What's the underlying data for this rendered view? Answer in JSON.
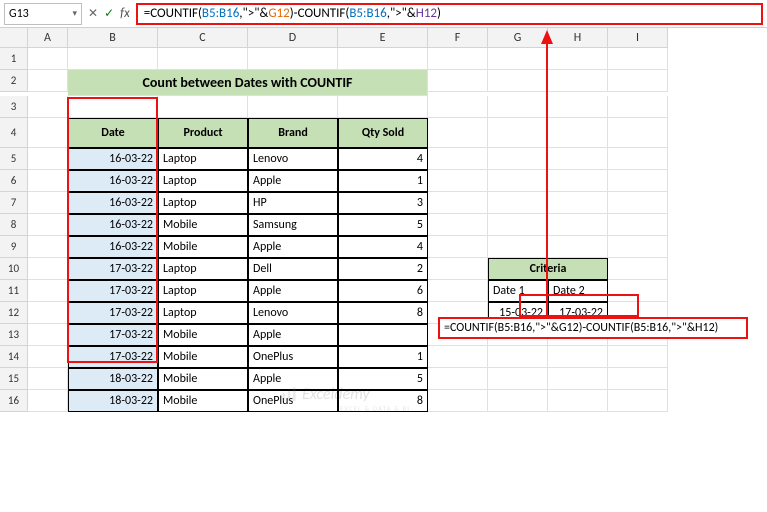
{
  "nameBox": "G13",
  "formulaBar": {
    "prefix": "=COUNTIF(",
    "r1": "B5:B16",
    "mid1": ",\">\"&",
    "g12": "G12",
    "mid2": ")-COUNTIF(",
    "r2": "B5:B16",
    "mid3": ",\">\"&",
    "h12": "H12",
    "suffix": ")"
  },
  "colHeaders": [
    "",
    "A",
    "B",
    "C",
    "D",
    "E",
    "F",
    "G",
    "H",
    "I"
  ],
  "title": "Count between Dates with COUNTIF",
  "headers": {
    "date": "Date",
    "product": "Product",
    "brand": "Brand",
    "qty": "Qty Sold"
  },
  "rows": [
    {
      "date": "16-03-22",
      "product": "Laptop",
      "brand": "Lenovo",
      "qty": "4"
    },
    {
      "date": "16-03-22",
      "product": "Laptop",
      "brand": "Apple",
      "qty": "1"
    },
    {
      "date": "16-03-22",
      "product": "Laptop",
      "brand": "HP",
      "qty": "3"
    },
    {
      "date": "16-03-22",
      "product": "Mobile",
      "brand": "Samsung",
      "qty": "5"
    },
    {
      "date": "16-03-22",
      "product": "Mobile",
      "brand": "Apple",
      "qty": "4"
    },
    {
      "date": "17-03-22",
      "product": "Laptop",
      "brand": "Dell",
      "qty": "2"
    },
    {
      "date": "17-03-22",
      "product": "Laptop",
      "brand": "Apple",
      "qty": "6"
    },
    {
      "date": "17-03-22",
      "product": "Laptop",
      "brand": "Lenovo",
      "qty": "8"
    },
    {
      "date": "17-03-22",
      "product": "Mobile",
      "brand": "Apple",
      "qty": ""
    },
    {
      "date": "17-03-22",
      "product": "Mobile",
      "brand": "OnePlus",
      "qty": "1"
    },
    {
      "date": "18-03-22",
      "product": "Mobile",
      "brand": "Apple",
      "qty": "5"
    },
    {
      "date": "18-03-22",
      "product": "Mobile",
      "brand": "OnePlus",
      "qty": "8"
    }
  ],
  "criteria": {
    "title": "Criteria",
    "label1": "Date 1",
    "label2": "Date 2",
    "val1": "15-03-22",
    "val2": "17-03-22"
  },
  "inlineFormula": "=COUNTIF(B5:B16,\">\"&G12)-COUNTIF(B5:B16,\">\"&H12)",
  "watermark": "Exceldemy",
  "watermarkSub": "EXCEL & DATA & BI"
}
